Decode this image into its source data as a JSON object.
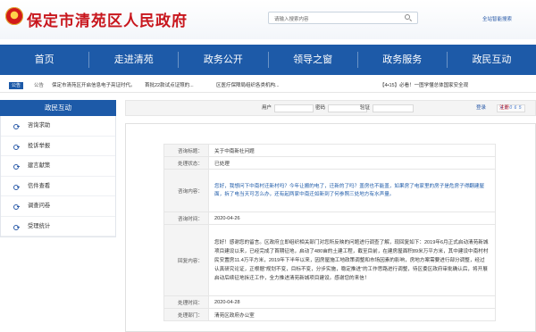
{
  "header": {
    "site_title": "保定市清苑区人民政府",
    "search_placeholder": "请输入搜索内容",
    "advanced_search": "全站智能搜索"
  },
  "nav": {
    "items": [
      "首页",
      "走进清苑",
      "政务公开",
      "领导之窗",
      "政务服务",
      "政民互动"
    ]
  },
  "ticker": {
    "tag": "公告",
    "label": "公告",
    "items": [
      "保定市清苑区开启信息电子亮证时代。",
      "首批22款试点证照的...",
      "区医疗保障局组织各类机构...",
      "【4•15】必看！一图学懂总体国家安全观"
    ]
  },
  "sidebar": {
    "title": "政民互动",
    "items": [
      "咨询求助",
      "投诉举报",
      "建言献策",
      "信件查看",
      "调查问卷",
      "受理统计"
    ]
  },
  "login": {
    "user_label": "用户",
    "password_label": "密码",
    "captcha_label": "验证",
    "captcha_text": "4 0 0 6 5",
    "login_button": "登录",
    "register_button": "注册"
  },
  "detail": {
    "rows": [
      {
        "key": "咨询标题：",
        "value": "关于中南新社问题"
      },
      {
        "key": "处理状态：",
        "value": "已处理"
      },
      {
        "key": "咨询内容：",
        "value": "您好，我想问下中南村迁新村吗？今年让搬的电了，迁新的了吗？盖房也不能盖，如果房了电家里的房子是危房子得翻建屋面，拆了电当天可怎么办，还有起两家中南迁如新到了何参照三处地方有水声量。"
      },
      {
        "key": "咨询时间：",
        "value": "2020-04-26"
      },
      {
        "key": "回复内容：",
        "value": "您好！感谢您的留言。区政府立即组织相关部门对您所反映的问题进行调查了解，现回复如下：2019年6月正式启动清苑新城项目建设以来，已经完成了首期征地，启动了480亩的土建工程，截至目前，在建房屋面积89米万平方米，其中建设中南村村民安置房11.4万平方米，2019年下半年以来，因房屋施工地政策调整和市场因素的影响，房地方案需要进行部分调整，经过认真研究论证，正根据“规划不变，目标不变，分步实施，稳定推进”的工作思路进行调整，待区委区政府审批确认后，将开展启动后续征地拆迁工作，全力推进清苑新城项目建设。感谢您的来信！"
      },
      {
        "key": "处理时间：",
        "value": "2020-04-28"
      },
      {
        "key": "处理部门：",
        "value": "清苑区政府办公室"
      }
    ]
  }
}
